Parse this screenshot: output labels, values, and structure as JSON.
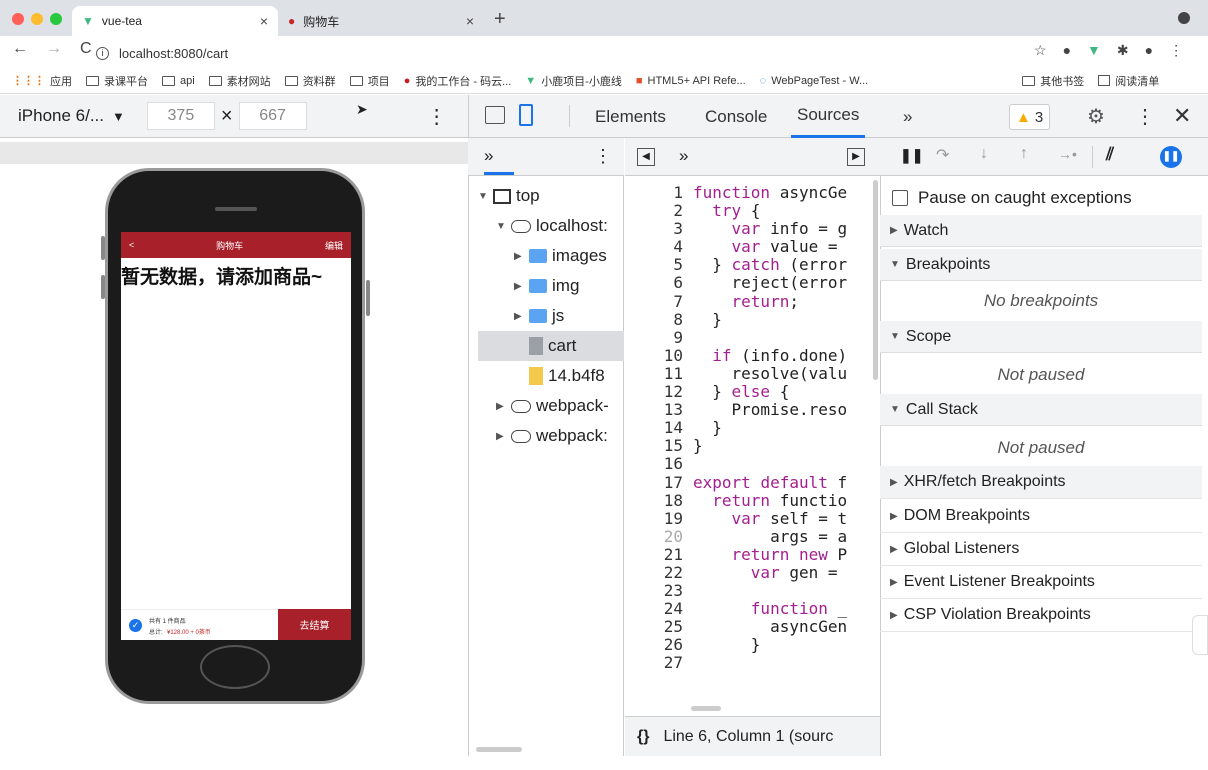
{
  "browser": {
    "tabs": [
      {
        "title": "vue-tea"
      },
      {
        "title": "购物车"
      }
    ],
    "url": "localhost:8080/cart",
    "bookmarks": [
      "应用",
      "录课平台",
      "api",
      "素材网站",
      "资料群",
      "项目",
      "我的工作台 - 码云...",
      "小鹿项目-小鹿线",
      "HTML5+ API Refe...",
      "WebPageTest - W...",
      "其他书签",
      "阅读清单"
    ]
  },
  "device_toolbar": {
    "device": "iPhone 6/...",
    "width": "375",
    "height": "667",
    "times": "×"
  },
  "app": {
    "back": "<",
    "title": "购物车",
    "edit": "编辑",
    "empty": "暂无数据，请添加商品~",
    "count_text": "共有 1 件商品",
    "total_label": "总计:",
    "total_value": "¥128.00 + 0茶币",
    "checkout": "去结算"
  },
  "devtools": {
    "tabs": [
      "Elements",
      "Console",
      "Sources"
    ],
    "more": "»",
    "warnings": "3",
    "tree": [
      {
        "label": "top",
        "type": "frame",
        "indent": 0,
        "arrow": "▼"
      },
      {
        "label": "localhost:",
        "type": "cloud",
        "indent": 1,
        "arrow": "▼"
      },
      {
        "label": "images",
        "type": "folder",
        "indent": 2,
        "arrow": "▶"
      },
      {
        "label": "img",
        "type": "folder",
        "indent": 2,
        "arrow": "▶"
      },
      {
        "label": "js",
        "type": "folder",
        "indent": 2,
        "arrow": "▶"
      },
      {
        "label": "cart",
        "type": "file",
        "indent": 2,
        "arrow": ""
      },
      {
        "label": "14.b4f8",
        "type": "jsfile",
        "indent": 2,
        "arrow": ""
      },
      {
        "label": "webpack-",
        "type": "cloud",
        "indent": 1,
        "arrow": "▶"
      },
      {
        "label": "webpack:",
        "type": "cloud",
        "indent": 1,
        "arrow": "▶"
      }
    ],
    "code_lines": [
      "function asyncGe",
      "  try {",
      "    var info = g",
      "    var value = ",
      "  } catch (error",
      "    reject(error",
      "    return;",
      "  }",
      "",
      "  if (info.done)",
      "    resolve(valu",
      "  } else {",
      "    Promise.reso",
      "  }",
      "}",
      "",
      "export default f",
      "  return functio",
      "    var self = t",
      "        args = a",
      "    return new P",
      "      var gen = ",
      "",
      "      function _",
      "        asyncGen",
      "      }",
      ""
    ],
    "status": "Line 6, Column 1  (sourc",
    "status_icon": "{}",
    "pause_caught": "Pause on caught exceptions",
    "sections": {
      "watch": "Watch",
      "breakpoints": "Breakpoints",
      "no_breakpoints": "No breakpoints",
      "scope": "Scope",
      "not_paused": "Not paused",
      "call_stack": "Call Stack",
      "not_paused_2": "Not paused",
      "xhr": "XHR/fetch Breakpoints",
      "dom": "DOM Breakpoints",
      "global": "Global Listeners",
      "event": "Event Listener Breakpoints",
      "csp": "CSP Violation Breakpoints"
    }
  },
  "colors": {
    "brand": "#a8212a",
    "link_blue": "#1a73e8",
    "warning": "#f9ab00"
  }
}
